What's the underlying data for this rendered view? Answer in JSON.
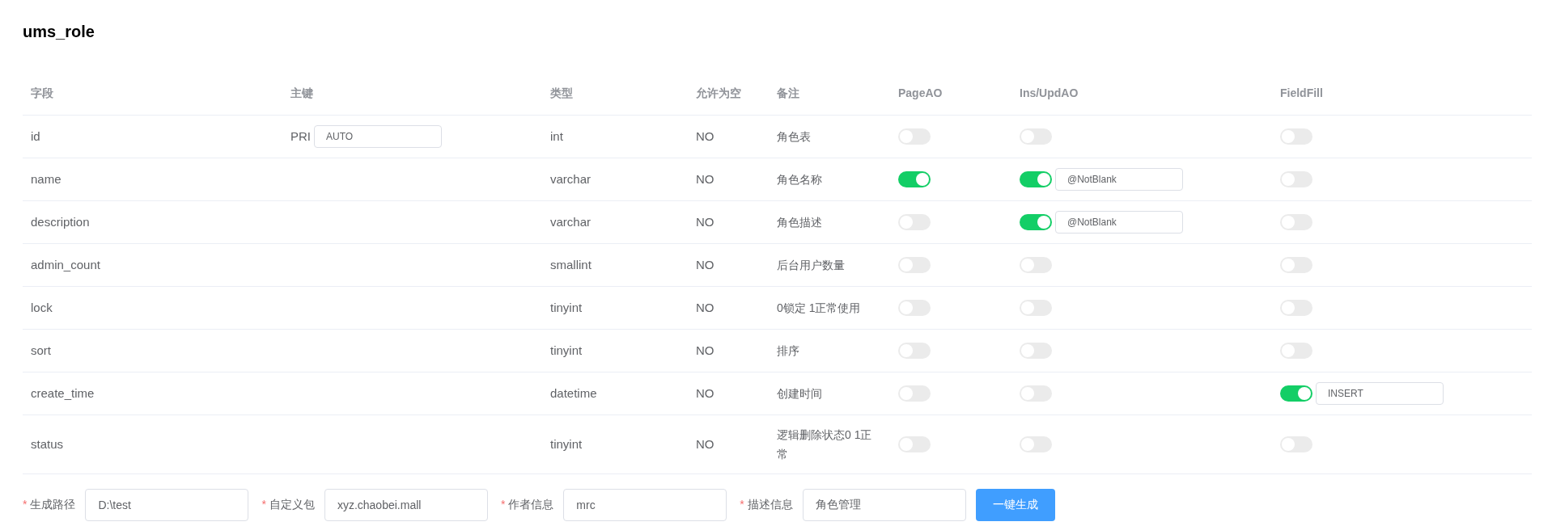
{
  "title": "ums_role",
  "table": {
    "columns": [
      "字段",
      "主键",
      "类型",
      "允许为空",
      "备注",
      "PageAO",
      "Ins/UpdAO",
      "FieldFill"
    ],
    "rows": [
      {
        "field": "id",
        "key": {
          "label": "PRI",
          "value": "AUTO"
        },
        "type": "int",
        "nullable": "NO",
        "comment": "角色表",
        "page_ao": {
          "on": false
        },
        "ins_upd_ao": {
          "on": false
        },
        "field_fill": {
          "on": false
        }
      },
      {
        "field": "name",
        "type": "varchar",
        "nullable": "NO",
        "comment": "角色名称",
        "page_ao": {
          "on": true
        },
        "ins_upd_ao": {
          "on": true,
          "value": "@NotBlank"
        },
        "field_fill": {
          "on": false
        }
      },
      {
        "field": "description",
        "type": "varchar",
        "nullable": "NO",
        "comment": "角色描述",
        "page_ao": {
          "on": false
        },
        "ins_upd_ao": {
          "on": true,
          "value": "@NotBlank"
        },
        "field_fill": {
          "on": false
        }
      },
      {
        "field": "admin_count",
        "type": "smallint",
        "nullable": "NO",
        "comment": "后台用户数量",
        "page_ao": {
          "on": false
        },
        "ins_upd_ao": {
          "on": false
        },
        "field_fill": {
          "on": false
        }
      },
      {
        "field": "lock",
        "type": "tinyint",
        "nullable": "NO",
        "comment": "0锁定 1正常使用",
        "page_ao": {
          "on": false
        },
        "ins_upd_ao": {
          "on": false
        },
        "field_fill": {
          "on": false
        }
      },
      {
        "field": "sort",
        "type": "tinyint",
        "nullable": "NO",
        "comment": "排序",
        "page_ao": {
          "on": false
        },
        "ins_upd_ao": {
          "on": false
        },
        "field_fill": {
          "on": false
        }
      },
      {
        "field": "create_time",
        "type": "datetime",
        "nullable": "NO",
        "comment": "创建时间",
        "page_ao": {
          "on": false
        },
        "ins_upd_ao": {
          "on": false
        },
        "field_fill": {
          "on": true,
          "value": "INSERT"
        }
      },
      {
        "field": "status",
        "type": "tinyint",
        "nullable": "NO",
        "comment": "逻辑删除状态0 1正常",
        "page_ao": {
          "on": false
        },
        "ins_upd_ao": {
          "on": false
        },
        "field_fill": {
          "on": false
        }
      }
    ]
  },
  "form": {
    "fields": [
      {
        "required_mark": "*",
        "label": "生成路径",
        "value": "D:\\test"
      },
      {
        "required_mark": "*",
        "label": "自定义包",
        "value": "xyz.chaobei.mall"
      },
      {
        "required_mark": "*",
        "label": "作者信息",
        "value": "mrc"
      },
      {
        "required_mark": "*",
        "label": "描述信息",
        "value": "角色管理"
      }
    ],
    "submit": "一键生成"
  }
}
